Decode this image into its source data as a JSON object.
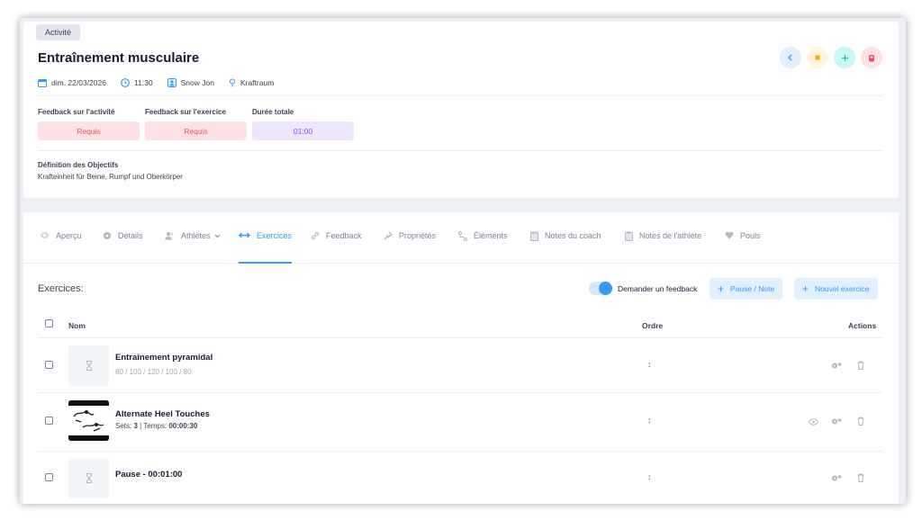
{
  "header": {
    "badge": "Activité",
    "title": "Entraînement musculaire",
    "meta": {
      "date": "dim. 22/03/2026",
      "time": "11:30",
      "athlete": "Snow Jon",
      "location": "Kraftraum"
    },
    "actions": [
      {
        "icon": "chevron-left-icon",
        "bg": "#e1f0ff",
        "color": "#3699ff"
      },
      {
        "icon": "stop-icon",
        "bg": "#fff4de",
        "color": "#ffa800"
      },
      {
        "icon": "plus-icon",
        "bg": "#c9f7f5",
        "color": "#1bc5bd"
      },
      {
        "icon": "trash-icon",
        "bg": "#ffe2e5",
        "color": "#f64e60"
      }
    ]
  },
  "feedback": {
    "activity_label": "Feedback sur l'activité",
    "activity_value": "Requis",
    "exercise_label": "Feedback sur l'exercice",
    "exercise_value": "Requis",
    "duration_label": "Durée totale",
    "duration_value": "01:00"
  },
  "objectives": {
    "label": "Définition des Objectifs",
    "value": "Krafteinheit für Beine, Rumpf und Oberkörper"
  },
  "tabs": [
    {
      "label": "Aperçu",
      "icon": "eye-icon"
    },
    {
      "label": "Détails",
      "icon": "gear-icon"
    },
    {
      "label": "Athlètes",
      "icon": "users-icon"
    },
    {
      "label": "Exercices",
      "icon": "arrows-h-icon"
    },
    {
      "label": "Feedback",
      "icon": "link-icon"
    },
    {
      "label": "Propriétés",
      "icon": "pin-icon"
    },
    {
      "label": "Éléments",
      "icon": "nodes-icon"
    },
    {
      "label": "Notes du coach",
      "icon": "clipboard-icon"
    },
    {
      "label": "Notes de l'athlète",
      "icon": "clipboard-icon"
    },
    {
      "label": "Pouls",
      "icon": "heart-icon"
    }
  ],
  "active_tab": "Exercices",
  "exercises": {
    "label": "Exercices:",
    "toggle_label": "Demander un feedback",
    "pause_button": "Pause / Note",
    "new_button": "Nouvel exercice",
    "columns": {
      "name": "Nom",
      "order": "Ordre",
      "actions": "Actions"
    },
    "rows": [
      {
        "name": "Entraînement pyramidal",
        "sub": "80 / 100 / 120 / 100 / 80",
        "thumb": "hourglass"
      },
      {
        "name": "Alternate Heel Touches",
        "sets_label": "Sets:",
        "sets": "3",
        "sep": "|",
        "time_label": "Temps:",
        "time": "00:00:30",
        "thumb": "image"
      },
      {
        "name": "Pause - 00:01:00",
        "thumb": "hourglass"
      }
    ]
  },
  "colors": {
    "primary": "#3699ff",
    "danger": "#f64e60",
    "danger_light": "#ffe2e5",
    "purple": "#8950fc",
    "purple_light": "#eee5ff"
  }
}
